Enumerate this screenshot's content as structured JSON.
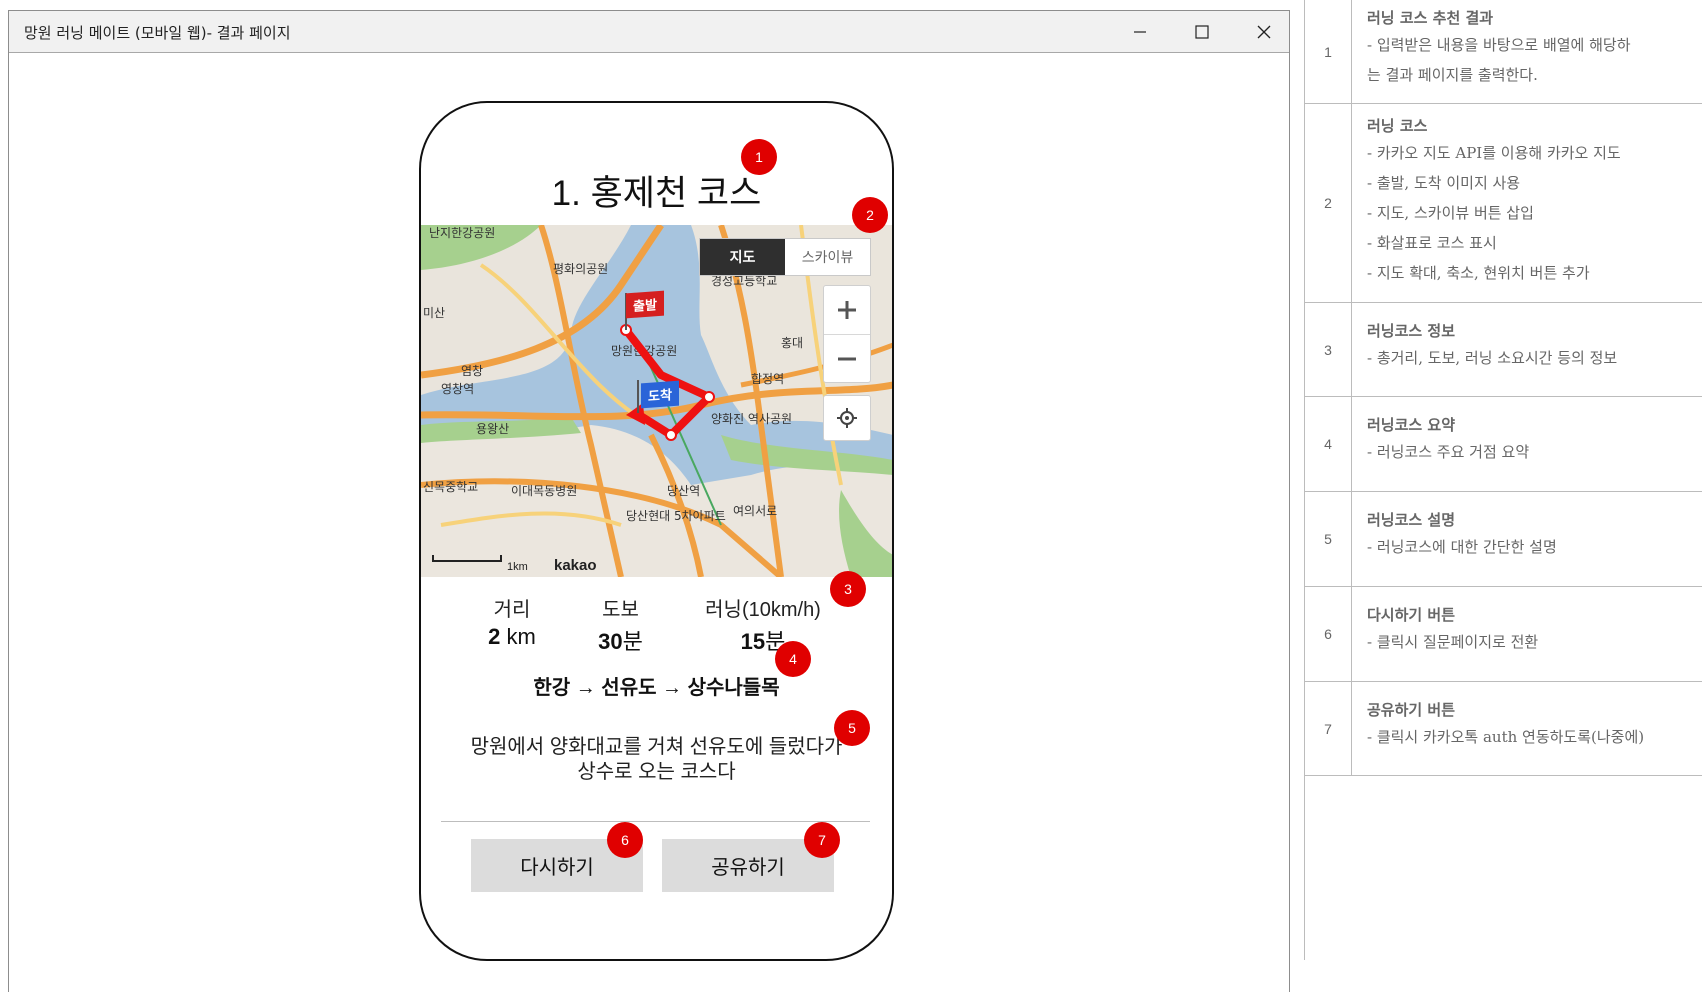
{
  "window": {
    "title": "망원 러닝 메이트 (모바일 웹)- 결과 페이지",
    "minimize_icon": "minimize-icon",
    "maximize_icon": "maximize-icon",
    "close_icon": "close-icon"
  },
  "result": {
    "course_title": "1. 홍제천 코스",
    "map": {
      "toggle": {
        "map_label": "지도",
        "skyview_label": "스카이뷰",
        "selected": "지도"
      },
      "zoom_in_icon": "plus-icon",
      "zoom_out_icon": "minus-icon",
      "location_icon": "current-location-icon",
      "start_flag": "출발",
      "end_flag": "도착",
      "scale_label": "1km",
      "logo": "kakao",
      "labels": [
        "난지한강공원",
        "평화의공원",
        "경성고등학교",
        "망원한강공원",
        "합정역",
        "양화진 역사공원",
        "용왕산",
        "이대목동병원",
        "신목중학교",
        "당산역",
        "당산현대 5차아파트",
        "여의서로",
        "홍대",
        "미산",
        "염창",
        "영창역"
      ],
      "colors": {
        "water": "#a7c4de",
        "road": "#f0a043",
        "park": "#a6d08e",
        "route": "#ee1111"
      }
    },
    "stats": [
      {
        "label": "거리",
        "value": "2",
        "unit": "km"
      },
      {
        "label": "도보",
        "value": "30",
        "unit": "분"
      },
      {
        "label": "러닝(10km/h)",
        "value": "15",
        "unit": "분"
      }
    ],
    "summary": "한강 → 선유도 → 상수나들목",
    "description_line1": "망원에서 양화대교를 거쳐 선유도에 들렀다가",
    "description_line2": "상수로 오는 코스다",
    "retry_button": "다시하기",
    "share_button": "공유하기",
    "badges": [
      "1",
      "2",
      "3",
      "4",
      "5",
      "6",
      "7"
    ],
    "badge_color": "#e00000"
  },
  "notes": [
    {
      "num": "1",
      "title": "러닝 코스 추천 결과",
      "lines": [
        "- 입력받은 내용을 바탕으로 배열에 해당하",
        "는 결과 페이지를 출력한다."
      ]
    },
    {
      "num": "2",
      "title": "러닝 코스",
      "lines": [
        "- 카카오 지도 API를 이용해 카카오 지도",
        "- 출발, 도착 이미지 사용",
        "- 지도, 스카이뷰 버튼 삽입",
        "- 화살표로 코스 표시",
        "- 지도 확대, 축소, 현위치 버튼 추가"
      ]
    },
    {
      "num": "3",
      "title": "러닝코스 정보",
      "lines": [
        " - 총거리, 도보, 러닝 소요시간 등의 정보"
      ]
    },
    {
      "num": "4",
      "title": "러닝코스 요약",
      "lines": [
        "- 러닝코스 주요 거점 요약"
      ]
    },
    {
      "num": "5",
      "title": "러닝코스 설명",
      "lines": [
        "- 러닝코스에 대한 간단한 설명"
      ]
    },
    {
      "num": "6",
      "title": "다시하기 버튼",
      "lines": [
        "- 클릭시 질문페이지로 전환"
      ]
    },
    {
      "num": "7",
      "title": "공유하기 버튼",
      "lines": [
        "- 클릭시 카카오톡 auth 연동하도록(나중에)"
      ]
    }
  ]
}
